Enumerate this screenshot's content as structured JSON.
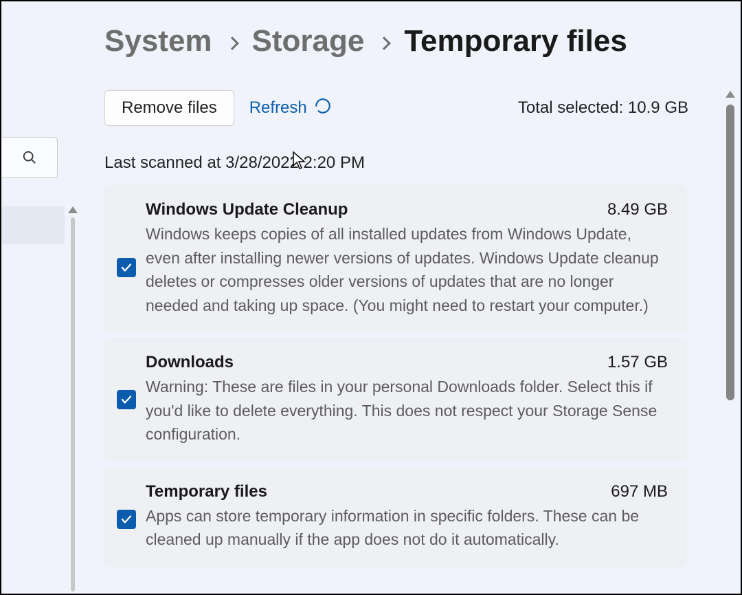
{
  "breadcrumb": {
    "level1": "System",
    "level2": "Storage",
    "level3": "Temporary files"
  },
  "toolbar": {
    "remove_label": "Remove files",
    "refresh_label": "Refresh",
    "total_selected_label": "Total selected: 10.9 GB"
  },
  "last_scanned": "Last scanned at 3/28/2022 2:20 PM",
  "items": [
    {
      "title": "Windows Update Cleanup",
      "size": "8.49 GB",
      "description": "Windows keeps copies of all installed updates from Windows Update, even after installing newer versions of updates. Windows Update cleanup deletes or compresses older versions of updates that are no longer needed and taking up space. (You might need to restart your computer.)",
      "checked": true
    },
    {
      "title": "Downloads",
      "size": "1.57 GB",
      "description": "Warning: These are files in your personal Downloads folder. Select this if you'd like to delete everything. This does not respect your Storage Sense configuration.",
      "checked": true
    },
    {
      "title": "Temporary files",
      "size": "697 MB",
      "description": "Apps can store temporary information in specific folders. These can be cleaned up manually if the app does not do it automatically.",
      "checked": true
    }
  ]
}
